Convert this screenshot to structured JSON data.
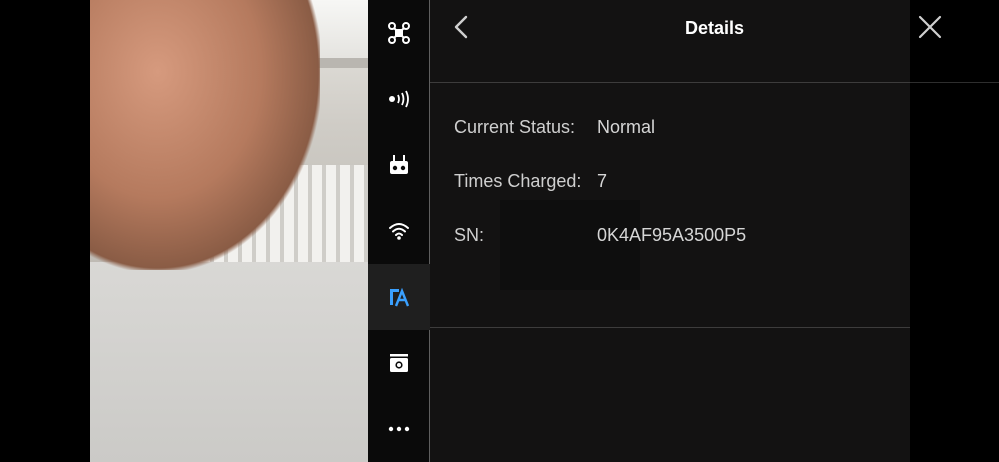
{
  "header": {
    "title": "Details",
    "back_icon": "chevron-left-icon",
    "close_icon": "close-icon"
  },
  "sidebar": {
    "items": [
      {
        "icon": "aircraft-icon",
        "active": false
      },
      {
        "icon": "signal-icon",
        "active": false
      },
      {
        "icon": "remote-controller-icon",
        "active": false
      },
      {
        "icon": "wifi-icon",
        "active": false
      },
      {
        "icon": "battery-icon",
        "active": true
      },
      {
        "icon": "camera-icon",
        "active": false
      },
      {
        "icon": "more-icon",
        "active": false
      }
    ],
    "active_color": "#3aa0ff"
  },
  "details": {
    "current_status_label": "Current Status:",
    "current_status_value": "Normal",
    "times_charged_label": "Times Charged:",
    "times_charged_value": "7",
    "sn_label": "SN:",
    "sn_value": "0K4AF95A3500P5"
  }
}
